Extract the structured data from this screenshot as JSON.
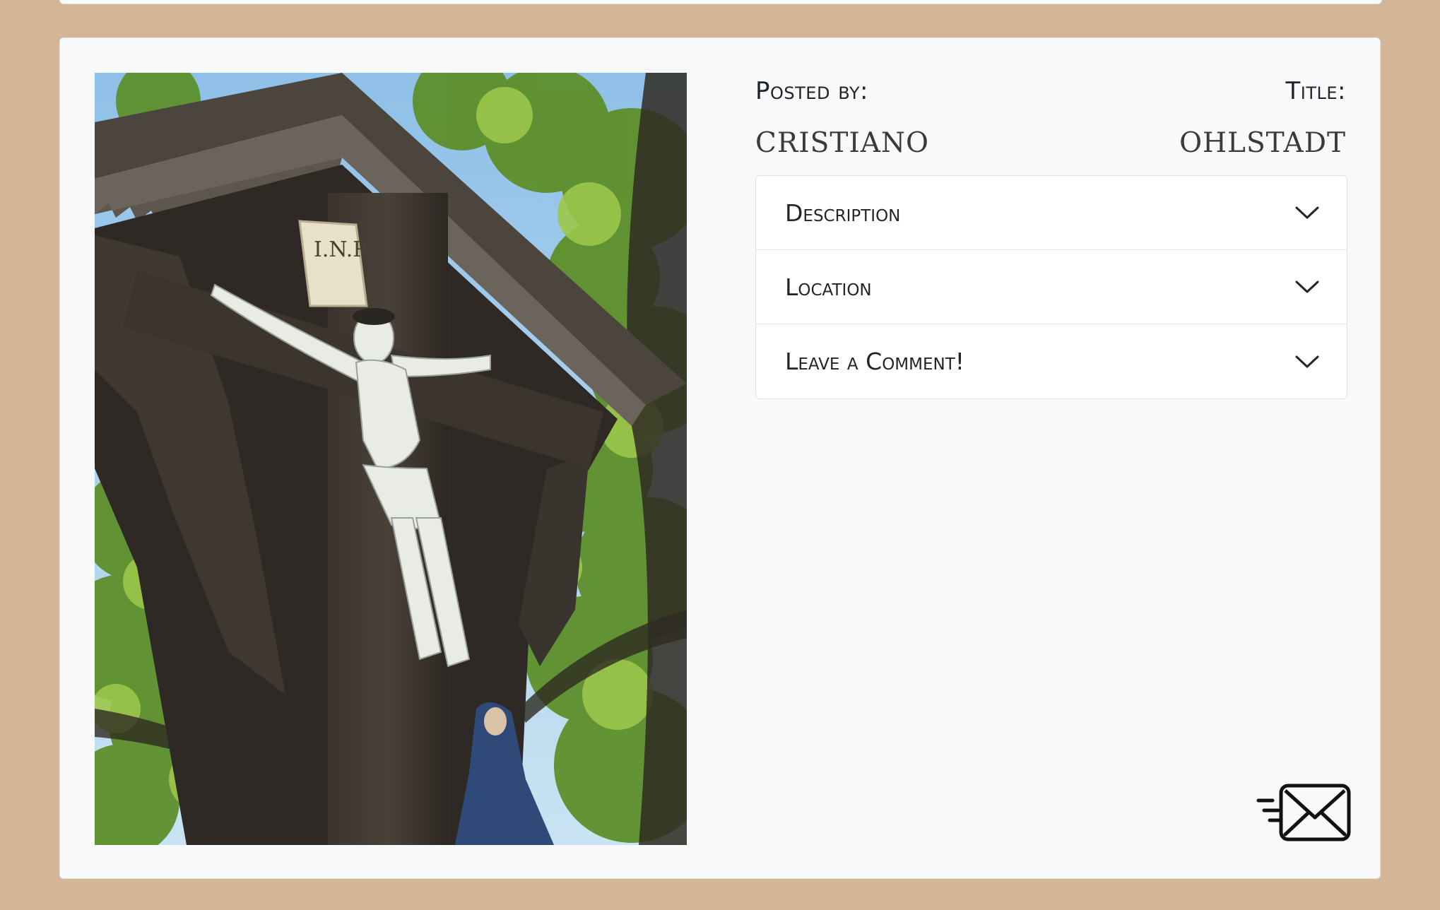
{
  "post": {
    "posted_by_label": "Posted by:",
    "title_label": "Title:",
    "author": "CRISTIANO",
    "title": "OHLSTADT"
  },
  "accordion": {
    "items": [
      {
        "label": "Description",
        "icon": "chevron-down-icon"
      },
      {
        "label": "Location",
        "icon": "chevron-down-icon"
      },
      {
        "label": "Leave a Comment!",
        "icon": "chevron-down-icon"
      }
    ]
  },
  "photo": {
    "plaque_text": "I.N.R.I"
  },
  "actions": {
    "send_icon": "send-mail-icon"
  },
  "colors": {
    "page_background": "#d4b596",
    "card_background": "#f8f9fa",
    "accordion_background": "#ffffff",
    "text": "#212529"
  }
}
